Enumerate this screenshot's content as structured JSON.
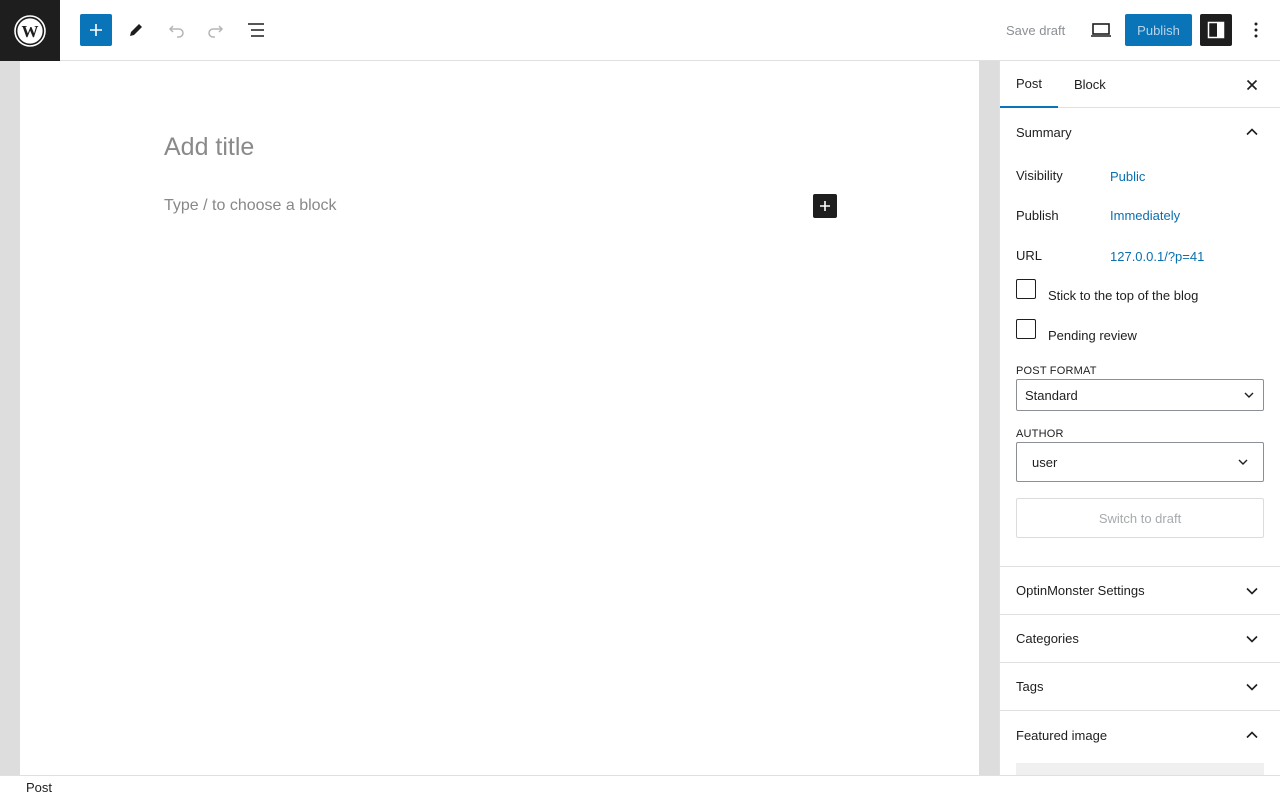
{
  "toolbar": {
    "save_draft_label": "Save draft",
    "publish_label": "Publish"
  },
  "editor": {
    "title_placeholder": "Add title",
    "block_placeholder": "Type / to choose a block"
  },
  "sidebar": {
    "tabs": [
      {
        "label": "Post",
        "active": true
      },
      {
        "label": "Block",
        "active": false
      }
    ],
    "summary": {
      "heading": "Summary",
      "rows": [
        {
          "label": "Visibility",
          "value": "Public"
        },
        {
          "label": "Publish",
          "value": "Immediately"
        },
        {
          "label": "URL",
          "value": "127.0.0.1/?p=41"
        }
      ],
      "checkboxes": [
        {
          "label": "Stick to the top of the blog",
          "checked": false
        },
        {
          "label": "Pending review",
          "checked": false
        }
      ],
      "post_format_label": "POST FORMAT",
      "post_format_value": "Standard",
      "author_label": "AUTHOR",
      "author_value": "user",
      "switch_to_draft_label": "Switch to draft"
    },
    "panels": [
      {
        "label": "OptinMonster Settings",
        "expanded": false
      },
      {
        "label": "Categories",
        "expanded": false
      },
      {
        "label": "Tags",
        "expanded": false
      },
      {
        "label": "Featured image",
        "expanded": true
      }
    ]
  },
  "footer": {
    "breadcrumb": "Post"
  },
  "colors": {
    "accent": "#0a74b8",
    "dark": "#1e1e1e",
    "link": "#0a6fb0"
  }
}
